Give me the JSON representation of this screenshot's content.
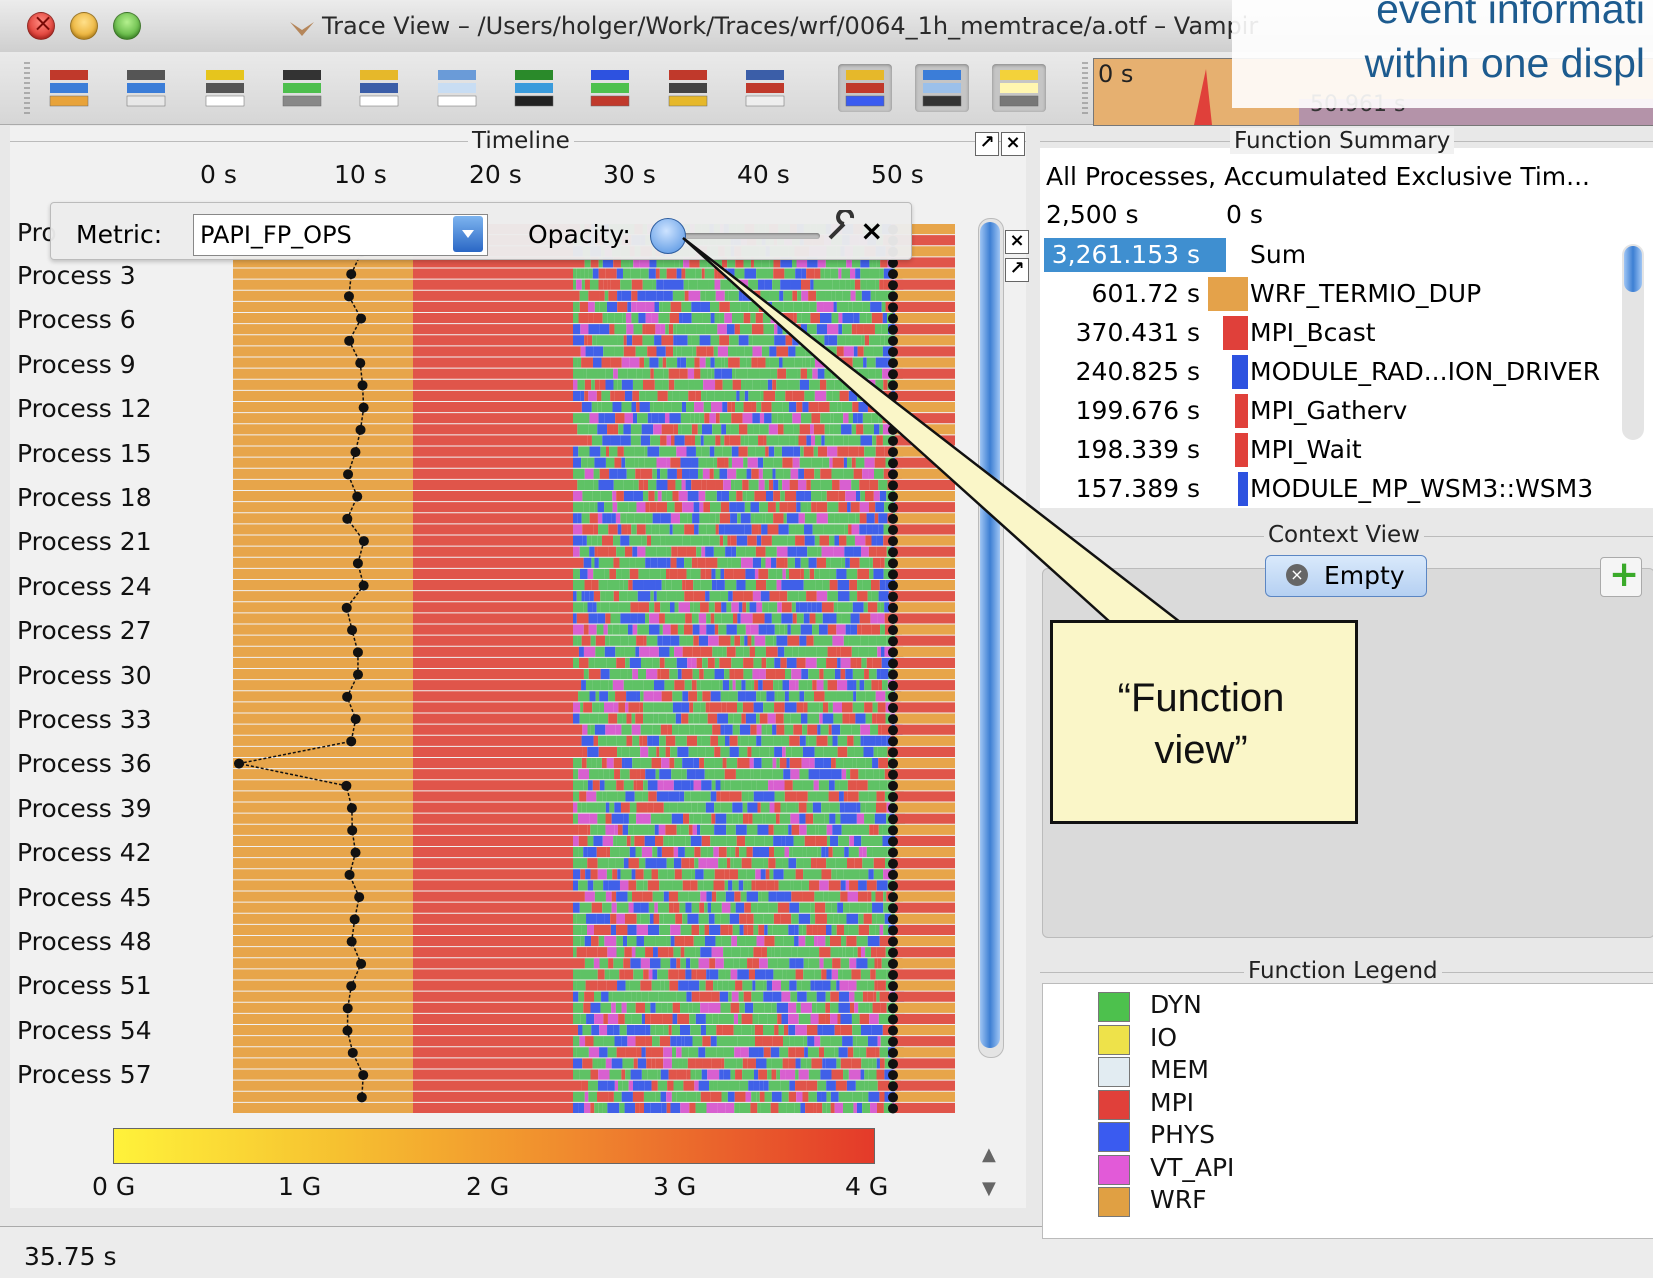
{
  "window": {
    "title": "Trace View – /Users/holger/Work/Traces/wrf/0064_1h_memtrace/a.otf – Vampir"
  },
  "slide_overlay": {
    "line1": "event informati",
    "line2": "within one displ"
  },
  "toolbar": {
    "buttons": [
      "master-timeline",
      "process-timeline",
      "counter-timeline",
      "performance-radar",
      "function-summary",
      "message-summary",
      "process-summary",
      "communication-matrix",
      "io-summary",
      "call-tree",
      "function-legend",
      "marker-view",
      "context-view"
    ],
    "overview_start": "0 s",
    "overview_end": "50.961 s"
  },
  "timeline": {
    "header": "Timeline",
    "axis_ticks": [
      "0 s",
      "10 s",
      "20 s",
      "30 s",
      "40 s",
      "50 s"
    ],
    "first_row_label": "Pro",
    "processes": [
      "Process 3",
      "Process 6",
      "Process 9",
      "Process 12",
      "Process 15",
      "Process 18",
      "Process 21",
      "Process 24",
      "Process 27",
      "Process 30",
      "Process 33",
      "Process 36",
      "Process 39",
      "Process 42",
      "Process 45",
      "Process 48",
      "Process 51",
      "Process 54",
      "Process 57"
    ],
    "metric_label": "Metric:",
    "metric_value": "PAPI_FP_OPS",
    "opacity_label": "Opacity:",
    "opacity_level": 0.1,
    "scale_labels": [
      "0 G",
      "1 G",
      "2 G",
      "3 G",
      "4 G"
    ]
  },
  "function_summary": {
    "header": "Function Summary",
    "subtitle": "All Processes, Accumulated Exclusive Tim...",
    "axis_left": "2,500 s",
    "axis_right": "0 s",
    "rows": [
      {
        "value": "3,261.153 s",
        "name": "Sum",
        "color": "#3f8fd0",
        "fraction": 1.0
      },
      {
        "value": "601.72 s",
        "name": "WRF_TERMIO_DUP",
        "color": "#e4a24a",
        "fraction": 0.24
      },
      {
        "value": "370.431 s",
        "name": "MPI_Bcast",
        "color": "#e0403a",
        "fraction": 0.15
      },
      {
        "value": "240.825 s",
        "name": "MODULE_RAD...ION_DRIVER",
        "color": "#2d52e0",
        "fraction": 0.1
      },
      {
        "value": "199.676 s",
        "name": "MPI_Gatherv",
        "color": "#e0403a",
        "fraction": 0.08
      },
      {
        "value": "198.339 s",
        "name": "MPI_Wait",
        "color": "#e0403a",
        "fraction": 0.08
      },
      {
        "value": "157.389 s",
        "name": "MODULE_MP_WSM3::WSM3",
        "color": "#2d52e0",
        "fraction": 0.06
      }
    ]
  },
  "context_view": {
    "header": "Context View",
    "tab_label": "Empty"
  },
  "function_legend": {
    "header": "Function Legend",
    "items": [
      {
        "name": "DYN",
        "color": "#4dc14d"
      },
      {
        "name": "IO",
        "color": "#eee24a"
      },
      {
        "name": "MEM",
        "color": "#e2ecf2"
      },
      {
        "name": "MPI",
        "color": "#e0403a"
      },
      {
        "name": "PHYS",
        "color": "#3a5bf0"
      },
      {
        "name": "VT_API",
        "color": "#e25ad8"
      },
      {
        "name": "WRF",
        "color": "#e0a043"
      }
    ]
  },
  "callout": {
    "text_line1": "“Function",
    "text_line2": "view”"
  },
  "status": {
    "time": "35.75 s"
  }
}
